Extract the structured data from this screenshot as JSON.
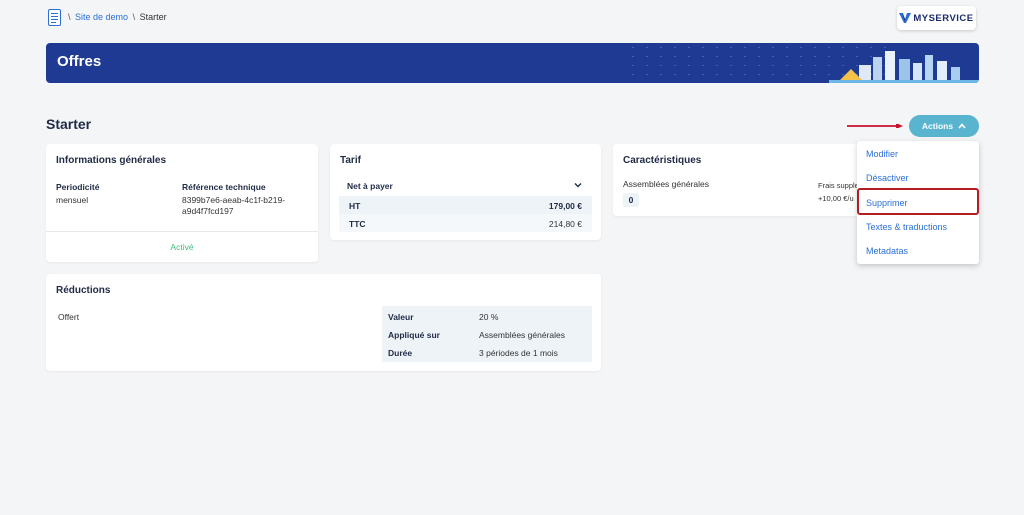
{
  "breadcrumb": {
    "sep1": "\\",
    "site": "Site de demo",
    "sep2": "\\",
    "current": "Starter"
  },
  "logo": {
    "text": "MYSERVICE",
    "icon": "myservice-logo-mark"
  },
  "banner": {
    "title": "Offres"
  },
  "page": {
    "title": "Starter"
  },
  "actions": {
    "label": "Actions",
    "icon": "chevron-up-icon",
    "menu": [
      "Modifier",
      "Désactiver",
      "Supprimer",
      "Textes & traductions",
      "Metadatas"
    ],
    "highlighted": "Supprimer"
  },
  "general_info": {
    "title": "Informations générales",
    "periodicity_label": "Periodicité",
    "periodicity_value": "mensuel",
    "ref_label": "Référence technique",
    "ref_value_1": "8399b7e6-aeab-4c1f-b219-",
    "ref_value_2": "a9d4f7fcd197",
    "status": "Activé",
    "status_color": "#3cbf7a"
  },
  "tarif": {
    "title": "Tarif",
    "selected": "Net à payer",
    "rows": [
      {
        "label": "HT",
        "value": "179,00 €"
      },
      {
        "label": "TTC",
        "value": "214,80 €"
      }
    ]
  },
  "caracteristiques": {
    "title": "Caractéristiques",
    "item_label": "Assemblées générales",
    "item_value": "0",
    "frais_line1": "Frais supple",
    "frais_line2": "+10,00 €/u"
  },
  "reductions": {
    "title": "Réductions",
    "name": "Offert",
    "rows": [
      {
        "label": "Valeur",
        "value": "20 %"
      },
      {
        "label": "Appliqué sur",
        "value": "Assemblées générales"
      },
      {
        "label": "Durée",
        "value": "3 périodes de 1 mois"
      }
    ]
  },
  "colors": {
    "banner": "#1f3a93",
    "accent": "#58b4cf",
    "link": "#2b6fd6",
    "highlight_border": "#b51d24",
    "arrow": "#c8102e"
  }
}
